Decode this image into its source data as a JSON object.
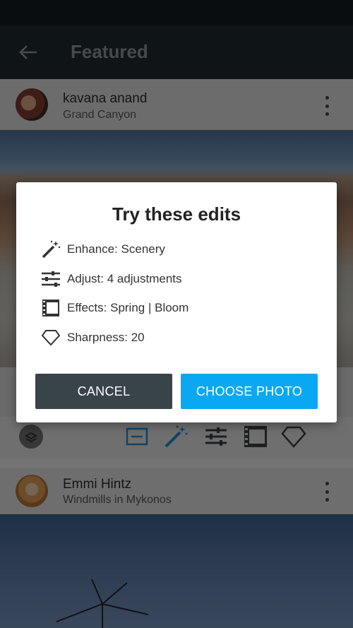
{
  "appbar": {
    "title": "Featured"
  },
  "card1": {
    "author": "kavana anand",
    "place": "Grand Canyon"
  },
  "card2": {
    "author": "Emmi Hintz",
    "place": "Windmills in Mykonos"
  },
  "toolbar": {
    "icons": [
      "stack-icon",
      "crop-icon",
      "magic-wand-icon",
      "sliders-icon",
      "film-icon",
      "diamond-icon"
    ],
    "active_color": "#1e88c8"
  },
  "dialog": {
    "title": "Try these edits",
    "edits": [
      {
        "icon": "magic-wand-icon",
        "label": "Enhance: Scenery"
      },
      {
        "icon": "sliders-icon",
        "label": "Adjust: 4 adjustments"
      },
      {
        "icon": "film-icon",
        "label": "Effects: Spring | Bloom"
      },
      {
        "icon": "diamond-icon",
        "label": "Sharpness: 20"
      }
    ],
    "cancel_label": "CANCEL",
    "choose_label": "CHOOSE PHOTO"
  },
  "colors": {
    "accent": "#0aa8f2",
    "cancel": "#39434a",
    "appbar": "#1f282c"
  }
}
